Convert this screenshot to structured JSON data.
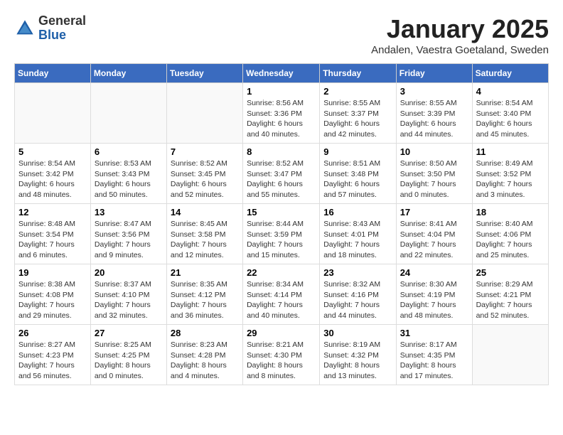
{
  "header": {
    "logo_general": "General",
    "logo_blue": "Blue",
    "month_title": "January 2025",
    "location": "Andalen, Vaestra Goetaland, Sweden"
  },
  "calendar": {
    "weekdays": [
      "Sunday",
      "Monday",
      "Tuesday",
      "Wednesday",
      "Thursday",
      "Friday",
      "Saturday"
    ],
    "weeks": [
      [
        {
          "day": "",
          "info": ""
        },
        {
          "day": "",
          "info": ""
        },
        {
          "day": "",
          "info": ""
        },
        {
          "day": "1",
          "info": "Sunrise: 8:56 AM\nSunset: 3:36 PM\nDaylight: 6 hours\nand 40 minutes."
        },
        {
          "day": "2",
          "info": "Sunrise: 8:55 AM\nSunset: 3:37 PM\nDaylight: 6 hours\nand 42 minutes."
        },
        {
          "day": "3",
          "info": "Sunrise: 8:55 AM\nSunset: 3:39 PM\nDaylight: 6 hours\nand 44 minutes."
        },
        {
          "day": "4",
          "info": "Sunrise: 8:54 AM\nSunset: 3:40 PM\nDaylight: 6 hours\nand 45 minutes."
        }
      ],
      [
        {
          "day": "5",
          "info": "Sunrise: 8:54 AM\nSunset: 3:42 PM\nDaylight: 6 hours\nand 48 minutes."
        },
        {
          "day": "6",
          "info": "Sunrise: 8:53 AM\nSunset: 3:43 PM\nDaylight: 6 hours\nand 50 minutes."
        },
        {
          "day": "7",
          "info": "Sunrise: 8:52 AM\nSunset: 3:45 PM\nDaylight: 6 hours\nand 52 minutes."
        },
        {
          "day": "8",
          "info": "Sunrise: 8:52 AM\nSunset: 3:47 PM\nDaylight: 6 hours\nand 55 minutes."
        },
        {
          "day": "9",
          "info": "Sunrise: 8:51 AM\nSunset: 3:48 PM\nDaylight: 6 hours\nand 57 minutes."
        },
        {
          "day": "10",
          "info": "Sunrise: 8:50 AM\nSunset: 3:50 PM\nDaylight: 7 hours\nand 0 minutes."
        },
        {
          "day": "11",
          "info": "Sunrise: 8:49 AM\nSunset: 3:52 PM\nDaylight: 7 hours\nand 3 minutes."
        }
      ],
      [
        {
          "day": "12",
          "info": "Sunrise: 8:48 AM\nSunset: 3:54 PM\nDaylight: 7 hours\nand 6 minutes."
        },
        {
          "day": "13",
          "info": "Sunrise: 8:47 AM\nSunset: 3:56 PM\nDaylight: 7 hours\nand 9 minutes."
        },
        {
          "day": "14",
          "info": "Sunrise: 8:45 AM\nSunset: 3:58 PM\nDaylight: 7 hours\nand 12 minutes."
        },
        {
          "day": "15",
          "info": "Sunrise: 8:44 AM\nSunset: 3:59 PM\nDaylight: 7 hours\nand 15 minutes."
        },
        {
          "day": "16",
          "info": "Sunrise: 8:43 AM\nSunset: 4:01 PM\nDaylight: 7 hours\nand 18 minutes."
        },
        {
          "day": "17",
          "info": "Sunrise: 8:41 AM\nSunset: 4:04 PM\nDaylight: 7 hours\nand 22 minutes."
        },
        {
          "day": "18",
          "info": "Sunrise: 8:40 AM\nSunset: 4:06 PM\nDaylight: 7 hours\nand 25 minutes."
        }
      ],
      [
        {
          "day": "19",
          "info": "Sunrise: 8:38 AM\nSunset: 4:08 PM\nDaylight: 7 hours\nand 29 minutes."
        },
        {
          "day": "20",
          "info": "Sunrise: 8:37 AM\nSunset: 4:10 PM\nDaylight: 7 hours\nand 32 minutes."
        },
        {
          "day": "21",
          "info": "Sunrise: 8:35 AM\nSunset: 4:12 PM\nDaylight: 7 hours\nand 36 minutes."
        },
        {
          "day": "22",
          "info": "Sunrise: 8:34 AM\nSunset: 4:14 PM\nDaylight: 7 hours\nand 40 minutes."
        },
        {
          "day": "23",
          "info": "Sunrise: 8:32 AM\nSunset: 4:16 PM\nDaylight: 7 hours\nand 44 minutes."
        },
        {
          "day": "24",
          "info": "Sunrise: 8:30 AM\nSunset: 4:19 PM\nDaylight: 7 hours\nand 48 minutes."
        },
        {
          "day": "25",
          "info": "Sunrise: 8:29 AM\nSunset: 4:21 PM\nDaylight: 7 hours\nand 52 minutes."
        }
      ],
      [
        {
          "day": "26",
          "info": "Sunrise: 8:27 AM\nSunset: 4:23 PM\nDaylight: 7 hours\nand 56 minutes."
        },
        {
          "day": "27",
          "info": "Sunrise: 8:25 AM\nSunset: 4:25 PM\nDaylight: 8 hours\nand 0 minutes."
        },
        {
          "day": "28",
          "info": "Sunrise: 8:23 AM\nSunset: 4:28 PM\nDaylight: 8 hours\nand 4 minutes."
        },
        {
          "day": "29",
          "info": "Sunrise: 8:21 AM\nSunset: 4:30 PM\nDaylight: 8 hours\nand 8 minutes."
        },
        {
          "day": "30",
          "info": "Sunrise: 8:19 AM\nSunset: 4:32 PM\nDaylight: 8 hours\nand 13 minutes."
        },
        {
          "day": "31",
          "info": "Sunrise: 8:17 AM\nSunset: 4:35 PM\nDaylight: 8 hours\nand 17 minutes."
        },
        {
          "day": "",
          "info": ""
        }
      ]
    ]
  }
}
